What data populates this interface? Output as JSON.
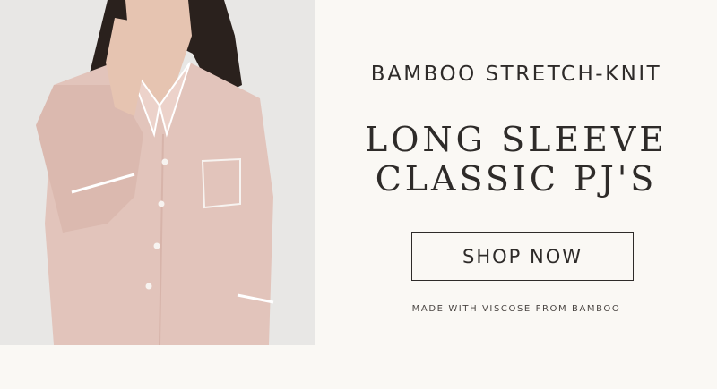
{
  "hero": {
    "image_alt": "model wearing blush long sleeve classic pajama shirt",
    "kicker": "BAMBOO STRETCH-KNIT",
    "headline_line1": "LONG SLEEVE",
    "headline_line2": "CLASSIC PJ'S",
    "cta_label": "SHOP NOW",
    "note": "MADE WITH VISCOSE FROM BAMBOO"
  },
  "colors": {
    "background": "#faf8f4",
    "text": "#2e2b29",
    "garment": "#e2c4bb"
  }
}
